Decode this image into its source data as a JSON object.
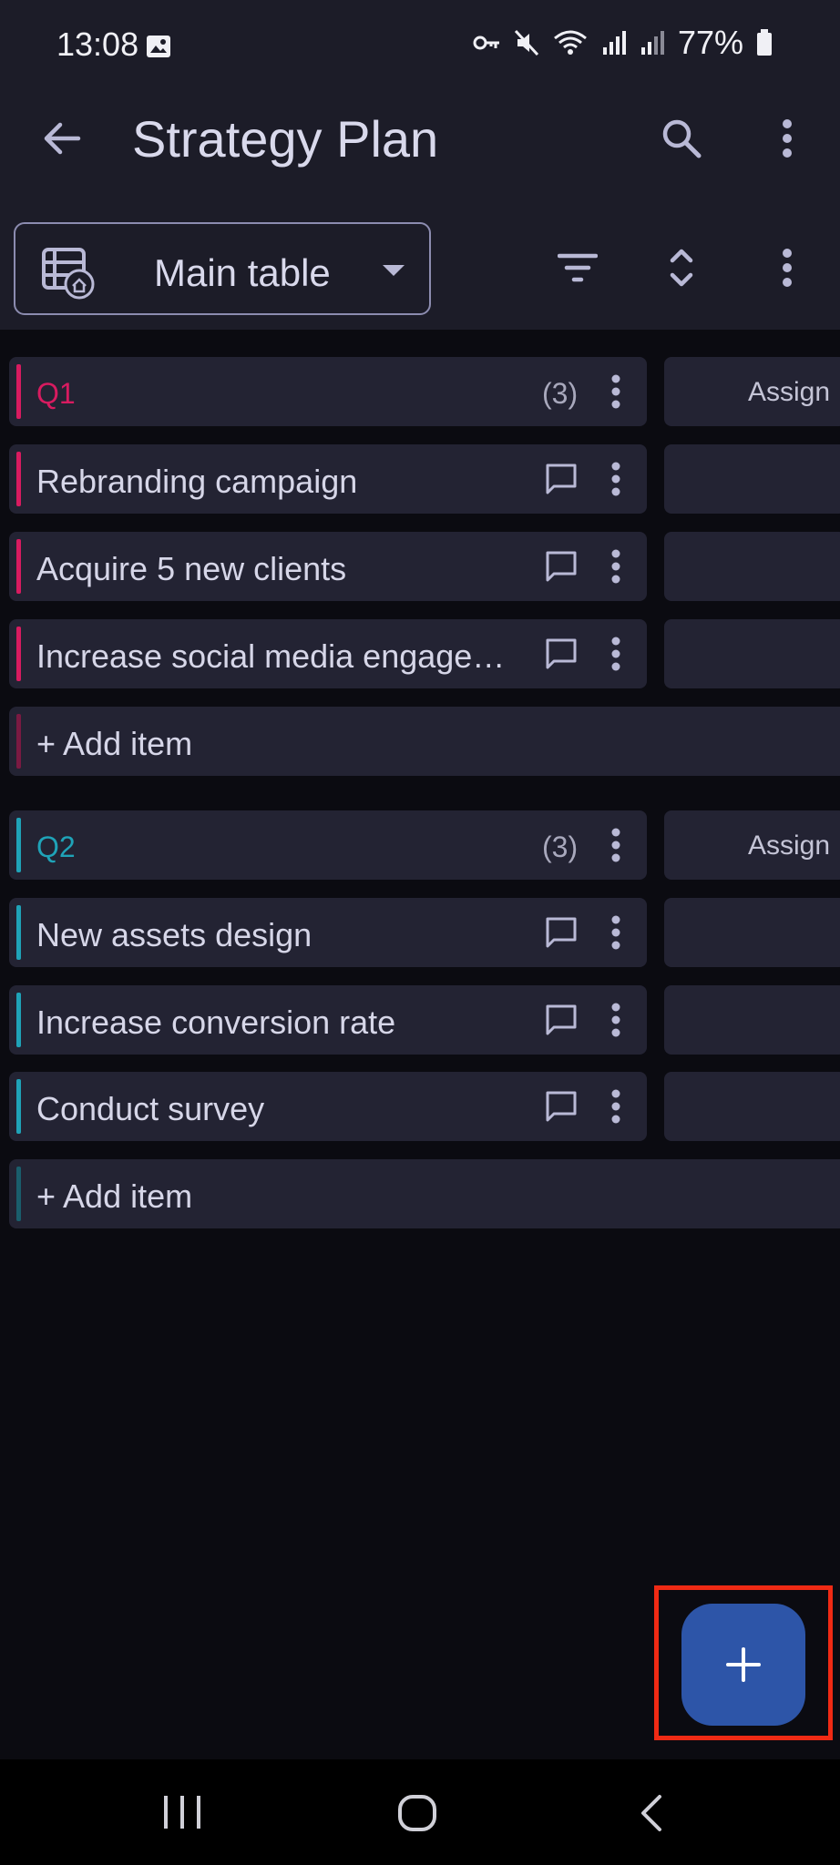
{
  "status": {
    "time": "13:08",
    "battery": "77%"
  },
  "header": {
    "title": "Strategy Plan"
  },
  "toolbar": {
    "table_name": "Main table"
  },
  "groups": [
    {
      "name": "Q1",
      "count": "(3)",
      "color": "#d81b60",
      "assign_label": "Assign",
      "items": [
        "Rebranding campaign",
        "Acquire 5 new clients",
        "Increase social media engage…"
      ],
      "add_label": "+ Add item"
    },
    {
      "name": "Q2",
      "count": "(3)",
      "color": "#1fa3b8",
      "assign_label": "Assign",
      "items": [
        "New assets design",
        "Increase conversion rate",
        "Conduct survey"
      ],
      "add_label": "+ Add item"
    }
  ],
  "fab": {
    "label": "+"
  },
  "colors": {
    "accent": "#2d55a8",
    "highlight": "#f02a14"
  }
}
